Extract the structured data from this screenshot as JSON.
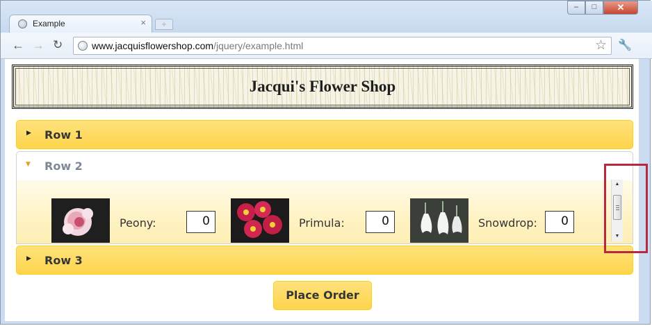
{
  "browser": {
    "tab_title": "Example",
    "tab_close": "×",
    "new_tab": "+",
    "url_host": "www.jacquisflowershop.com",
    "url_path": "/jquery/example.html",
    "window_buttons": {
      "minimize": "–",
      "maximize": "□",
      "close": "✕"
    }
  },
  "page": {
    "banner_title": "Jacqui's Flower Shop",
    "accordion": [
      {
        "label": "Row 1",
        "expanded": false
      },
      {
        "label": "Row 2",
        "expanded": true
      },
      {
        "label": "Row 3",
        "expanded": false
      }
    ],
    "products": [
      {
        "name": "Peony:",
        "quantity": "0",
        "image": "peony-image"
      },
      {
        "name": "Primula:",
        "quantity": "0",
        "image": "primula-image"
      },
      {
        "name": "Snowdrop:",
        "quantity": "0",
        "image": "snowdrop-image"
      }
    ],
    "order_button": "Place Order"
  },
  "colors": {
    "accordion_header": "#fdd44c",
    "highlight": "#b8283e"
  },
  "icons": {
    "back": "back-arrow-icon",
    "forward": "forward-arrow-icon",
    "reload": "reload-icon",
    "star": "bookmark-star-icon",
    "wrench": "wrench-icon"
  }
}
